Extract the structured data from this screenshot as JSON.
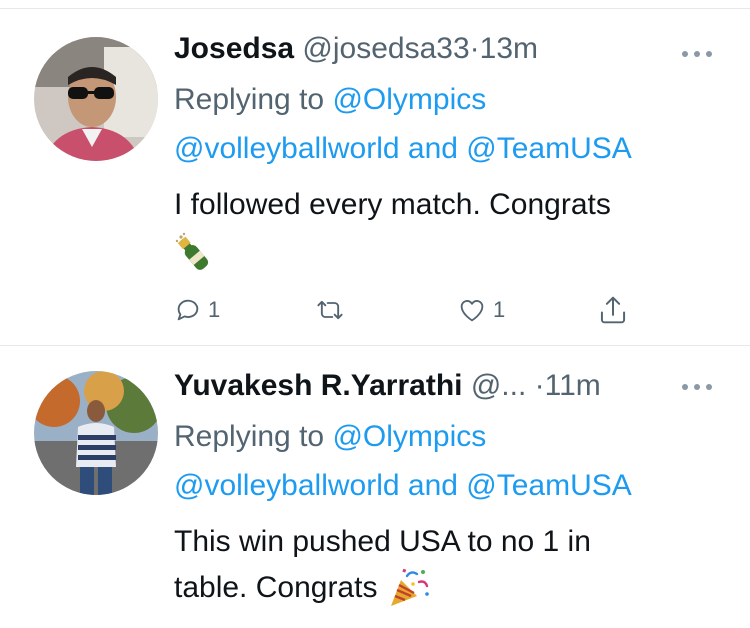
{
  "tweets": [
    {
      "display_name": "Josedsa",
      "handle": "@josedsa33",
      "separator": "·",
      "time": "13m",
      "replying_prefix": "Replying to",
      "replying_to": [
        "@Olympics",
        "@volleyballworld"
      ],
      "replying_joiner": "and",
      "replying_last": "@TeamUSA",
      "text": "I followed every match. Congrats",
      "emoji": "champagne-bottle",
      "replies": "1",
      "retweets": "",
      "likes": "1"
    },
    {
      "display_name": "Yuvakesh R.Yarrathi",
      "handle": "@...",
      "separator": "·",
      "time": "11m",
      "replying_prefix": "Replying to",
      "replying_to": [
        "@Olympics",
        "@volleyballworld"
      ],
      "replying_joiner": "and",
      "replying_last": "@TeamUSA",
      "text_line1": "This win pushed USA to no 1 in",
      "text_line2": "table. Congrats",
      "emoji": "party-popper"
    }
  ],
  "colors": {
    "link": "#1d9bf0",
    "muted": "#536471",
    "text": "#0f1419"
  }
}
